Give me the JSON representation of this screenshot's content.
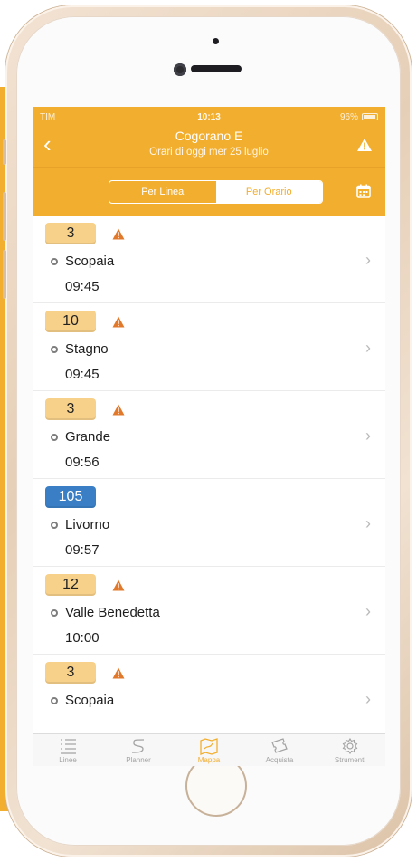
{
  "status_bar": {
    "carrier": "TIM",
    "time": "10:13",
    "battery": "96%"
  },
  "header": {
    "back_label": "‹",
    "title": "Cogorano E",
    "subtitle": "Orari di oggi mer 25 luglio"
  },
  "segmented": {
    "options": [
      {
        "label": "Per Linea",
        "active": false
      },
      {
        "label": "Per Orario",
        "active": true
      }
    ]
  },
  "departures": [
    {
      "line": "3",
      "color": "#f7d08a",
      "warning": true,
      "destination": "Scopaia",
      "time": "09:45"
    },
    {
      "line": "10",
      "color": "#f7d08a",
      "warning": true,
      "destination": "Stagno",
      "time": "09:45"
    },
    {
      "line": "3",
      "color": "#f7d08a",
      "warning": true,
      "destination": "Grande",
      "time": "09:56"
    },
    {
      "line": "105",
      "color": "#3a7fc6",
      "warning": false,
      "destination": "Livorno",
      "time": "09:57"
    },
    {
      "line": "12",
      "color": "#f7d08a",
      "warning": true,
      "destination": "Valle Benedetta",
      "time": "10:00"
    },
    {
      "line": "3",
      "color": "#f7d08a",
      "warning": true,
      "destination": "Scopaia",
      "time": ""
    }
  ],
  "tabbar": {
    "tabs": [
      {
        "label": "Linee",
        "icon": "list-icon",
        "active": false
      },
      {
        "label": "Planner",
        "icon": "route-icon",
        "active": false
      },
      {
        "label": "Mappa",
        "icon": "map-icon",
        "active": true
      },
      {
        "label": "Acquista",
        "icon": "ticket-icon",
        "active": false
      },
      {
        "label": "Strumenti",
        "icon": "gear-icon",
        "active": false
      }
    ]
  },
  "colors": {
    "accent": "#f2ae2e",
    "badge_default": "#f7d08a",
    "badge_blue": "#3a7fc6",
    "warning": "#e2792a"
  }
}
